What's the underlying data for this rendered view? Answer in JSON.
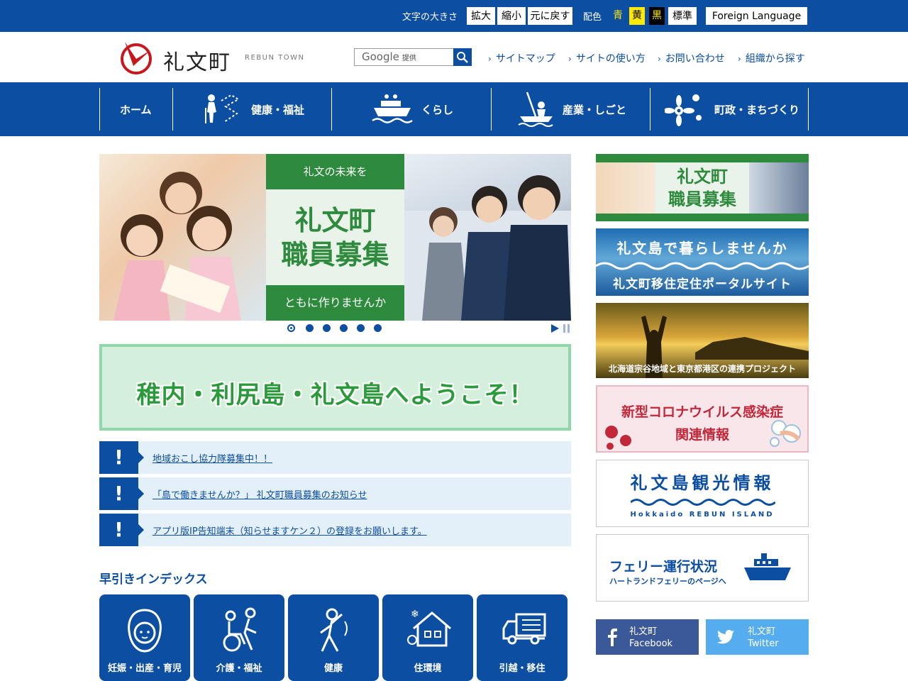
{
  "topbar": {
    "font_size_label": "文字の大きさ",
    "enlarge": "拡大",
    "shrink": "縮小",
    "reset": "元に戻す",
    "color_label": "配色",
    "color_blue": "青",
    "color_yellow": "黄",
    "color_black": "黒",
    "color_standard": "標準",
    "foreign_language": "Foreign Language"
  },
  "header": {
    "logo_text": "礼文町",
    "logo_sub": "REBUN TOWN",
    "search_brand": "Google",
    "search_provided": "提供",
    "links": [
      "サイトマップ",
      "サイトの使い方",
      "お問い合わせ",
      "組織から探す"
    ]
  },
  "gnav": {
    "home": "ホーム",
    "health": "健康・福祉",
    "life": "くらし",
    "industry": "産業・しごと",
    "town": "町政・まちづくり"
  },
  "slideshow": {
    "top": "礼文の未来を",
    "main": "礼文町\n職員募集",
    "bottom": "ともに作りませんか",
    "dot_count": 6,
    "active_dot": 1
  },
  "welcome": "稚内・利尻島・礼文島へようこそ！",
  "notices": [
    {
      "bang": "!",
      "text": "地域おこし協力隊募集中！！"
    },
    {
      "bang": "!",
      "text": "「島で働きませんか？」 礼文町職員募集のお知らせ"
    },
    {
      "bang": "!",
      "text": "アプリ版IP告知端末（知らせますケン２）の登録をお願いします。"
    }
  ],
  "index": {
    "title": "早引きインデックス",
    "cards": [
      "妊娠・出産・育児",
      "介護・福祉",
      "健康",
      "住環境",
      "引越・移住"
    ]
  },
  "sidebar": {
    "recruit": "礼文町\n職員募集",
    "live_1": "礼文島で暮らしませんか",
    "live_2": "礼文町移住定住ポータルサイト",
    "project": "北海道宗谷地域と東京都港区の連携プロジェクト",
    "covid": "新型コロナウイルス感染症\n関連情報",
    "tourism": "礼文島観光情報",
    "tourism_sub": "Hokkaido REBUN ISLAND",
    "ferry": "フェリー運行状況",
    "ferry_sub": "ハートランドフェリーのページへ",
    "facebook": "礼文町\nFacebook",
    "twitter": "礼文町\nTwitter"
  },
  "colors": {
    "brand_blue": "#0c4ea2",
    "green": "#2e8b3e",
    "facebook": "#3b5998",
    "twitter": "#55acee"
  }
}
